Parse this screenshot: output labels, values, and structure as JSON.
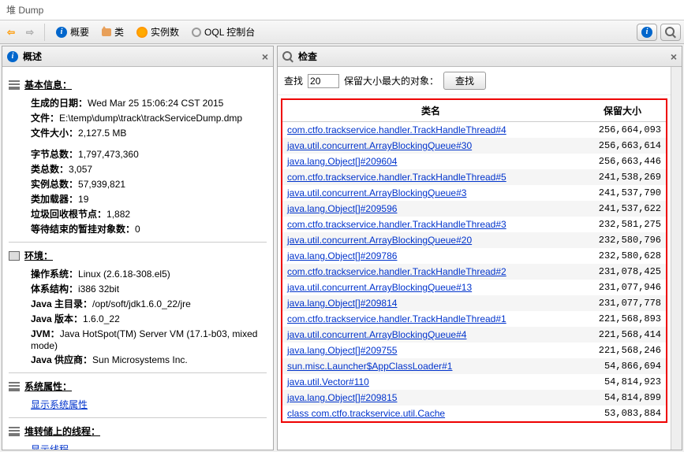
{
  "title": "堆 Dump",
  "toolbar": {
    "overview": "概要",
    "class": "类",
    "instances": "实例数",
    "oql": "OQL 控制台"
  },
  "left": {
    "header": "概述",
    "basic": {
      "title": "基本信息：",
      "date_label": "生成的日期：",
      "date_val": "Wed Mar 25 15:06:24 CST 2015",
      "file_label": "文件：",
      "file_val": "E:\\temp\\dump\\track\\trackServiceDump.dmp",
      "size_label": "文件大小：",
      "size_val": "2,127.5 MB",
      "bytes_label": "字节总数：",
      "bytes_val": "1,797,473,360",
      "classes_label": "类总数：",
      "classes_val": "3,057",
      "inst_label": "实例总数：",
      "inst_val": "57,939,821",
      "loaders_label": "类加载器：",
      "loaders_val": "19",
      "gc_label": "垃圾回收根节点：",
      "gc_val": "1,882",
      "pending_label": "等待结束的暂挂对象数：",
      "pending_val": "0"
    },
    "env": {
      "title": "环境：",
      "os_label": "操作系统：",
      "os_val": "Linux (2.6.18-308.el5)",
      "arch_label": "体系结构：",
      "arch_val": "i386 32bit",
      "home_label": "Java 主目录：",
      "home_val": "/opt/soft/jdk1.6.0_22/jre",
      "ver_label": "Java 版本：",
      "ver_val": "1.6.0_22",
      "jvm_label": "JVM：",
      "jvm_val": "Java HotSpot(TM) Server VM (17.1-b03, mixed mode)",
      "vendor_label": "Java 供应商：",
      "vendor_val": "Sun Microsystems Inc."
    },
    "sysprops": {
      "title": "系统属性：",
      "link": "显示系统属性"
    },
    "threads": {
      "title": "堆转储上的线程：",
      "link": "显示线程"
    }
  },
  "right": {
    "header": "检查",
    "search_prefix": "查找",
    "search_count": 20,
    "search_suffix": "保留大小最大的对象：",
    "search_btn": "查找",
    "col_class": "类名",
    "col_size": "保留大小",
    "rows": [
      {
        "cls": "com.ctfo.trackservice.handler.TrackHandleThread#4",
        "size": "256,664,093"
      },
      {
        "cls": "java.util.concurrent.ArrayBlockingQueue#30",
        "size": "256,663,614"
      },
      {
        "cls": "java.lang.Object[]#209604",
        "size": "256,663,446"
      },
      {
        "cls": "com.ctfo.trackservice.handler.TrackHandleThread#5",
        "size": "241,538,269"
      },
      {
        "cls": "java.util.concurrent.ArrayBlockingQueue#3",
        "size": "241,537,790"
      },
      {
        "cls": "java.lang.Object[]#209596",
        "size": "241,537,622"
      },
      {
        "cls": "com.ctfo.trackservice.handler.TrackHandleThread#3",
        "size": "232,581,275"
      },
      {
        "cls": "java.util.concurrent.ArrayBlockingQueue#20",
        "size": "232,580,796"
      },
      {
        "cls": "java.lang.Object[]#209786",
        "size": "232,580,628"
      },
      {
        "cls": "com.ctfo.trackservice.handler.TrackHandleThread#2",
        "size": "231,078,425"
      },
      {
        "cls": "java.util.concurrent.ArrayBlockingQueue#13",
        "size": "231,077,946"
      },
      {
        "cls": "java.lang.Object[]#209814",
        "size": "231,077,778"
      },
      {
        "cls": "com.ctfo.trackservice.handler.TrackHandleThread#1",
        "size": "221,568,893"
      },
      {
        "cls": "java.util.concurrent.ArrayBlockingQueue#4",
        "size": "221,568,414"
      },
      {
        "cls": "java.lang.Object[]#209755",
        "size": "221,568,246"
      },
      {
        "cls": "sun.misc.Launcher$AppClassLoader#1",
        "size": "54,866,694"
      },
      {
        "cls": "java.util.Vector#110",
        "size": "54,814,923"
      },
      {
        "cls": "java.lang.Object[]#209815",
        "size": "54,814,899"
      },
      {
        "cls": "class com.ctfo.trackservice.util.Cache",
        "size": "53,083,884"
      }
    ]
  }
}
